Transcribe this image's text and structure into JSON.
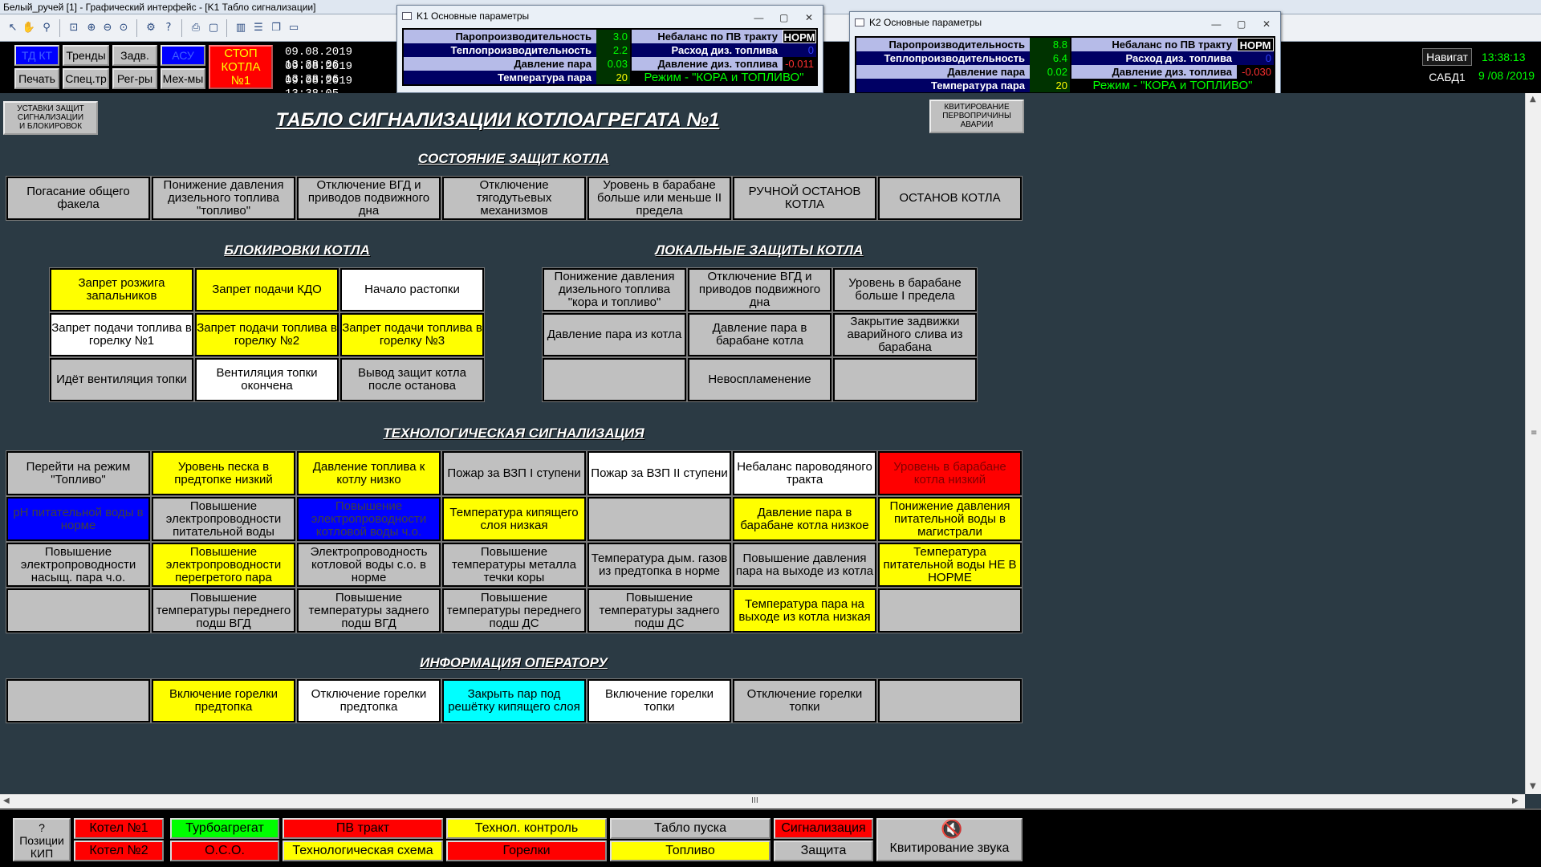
{
  "app": {
    "title": "Белый_ручей [1] - Графический интерфейс - [K1 Табло сигнализации]"
  },
  "toolbar": {
    "icons": [
      "cursor-icon",
      "hand-icon",
      "zoom-icon",
      "fit-icon",
      "zoom-in-icon",
      "zoom-out-icon",
      "zoom-reset-icon",
      "tools-icon",
      "help-icon",
      "print-icon",
      "window-icon",
      "layout-icon",
      "list-icon",
      "windows-icon",
      "screen-icon"
    ]
  },
  "cmd": {
    "row1": [
      "ТД КТ",
      "Тренды",
      "Задв.",
      "АСУ"
    ],
    "row2": [
      "Печать",
      "Спец.тр",
      "Рег-ры",
      "Мех-мы"
    ],
    "stop": [
      "СТОП",
      "КОТЛА",
      "№1"
    ],
    "datetimes": [
      "09.08.2019 13:38:06",
      "09.08.2019 13:38:06",
      "09.08.2019 13:38:05"
    ],
    "nav_label": "Навигат",
    "sabd_label": "САБД1",
    "clock_time": "13:38:13",
    "clock_date": "9 /08 /2019"
  },
  "k1": {
    "title": "K1 Основные параметры",
    "rows": [
      {
        "label": "Паропроизводительность",
        "value": "3.0",
        "value_color": "green"
      },
      {
        "label": "Теплопроизводительность",
        "value": "2.2",
        "value_color": "green"
      },
      {
        "label": "Давление пара",
        "value": "0.03",
        "value_color": "green"
      },
      {
        "label": "Температура пара",
        "value": "20",
        "value_color": "yellow"
      }
    ],
    "right_rows": [
      {
        "label": "Небаланс по ПВ тракту",
        "value": "НОРМ"
      },
      {
        "label": "Расход диз. топлива",
        "value": "0"
      },
      {
        "label": "Давление диз. топлива",
        "value": "-0.011"
      }
    ],
    "mode": "Режим - \"КОРА и ТОПЛИВО\""
  },
  "k2": {
    "title": "K2 Основные параметры",
    "rows": [
      {
        "label": "Паропроизводительность",
        "value": "8.8"
      },
      {
        "label": "Теплопроизводительность",
        "value": "6.4"
      },
      {
        "label": "Давление пара",
        "value": "0.02"
      },
      {
        "label": "Температура пара",
        "value": "20"
      }
    ],
    "right_rows": [
      {
        "label": "Небаланс по ПВ тракту",
        "value": "НОРМ"
      },
      {
        "label": "Расход диз. топлива",
        "value": "0"
      },
      {
        "label": "Давление диз. топлива",
        "value": "-0.030"
      }
    ],
    "mode": "Режим - \"КОРА и ТОПЛИВО\""
  },
  "panel": {
    "left_button": [
      "УСТАВКИ ЗАЩИТ",
      "СИГНАЛИЗАЦИИ",
      "И БЛОКИРОВОК"
    ],
    "right_button": [
      "КВИТИРОВАНИЕ",
      "ПЕРВОПРИЧИНЫ",
      "АВАРИИ"
    ],
    "title": "ТАБЛО СИГНАЛИЗАЦИИ КОТЛОАГРЕГАТА №1",
    "sections": {
      "protection": "СОСТОЯНИЕ ЗАЩИТ КОТЛА",
      "blocking": "БЛОКИРОВКИ КОТЛА",
      "local": "ЛОКАЛЬНЫЕ ЗАЩИТЫ КОТЛА",
      "tech": "ТЕХНОЛОГИЧЕСКАЯ СИГНАЛИЗАЦИЯ",
      "info": "ИНФОРМАЦИЯ ОПЕРАТОРУ"
    },
    "protection_cells": [
      {
        "text": "Погасание общего факела",
        "color": "gray"
      },
      {
        "text": "Понижение давления дизельного топлива \"топливо\"",
        "color": "gray"
      },
      {
        "text": "Отключение ВГД и приводов подвижного дна",
        "color": "gray"
      },
      {
        "text": "Отключение тягодутьевых механизмов",
        "color": "gray"
      },
      {
        "text": "Уровень в барабане больше или меньше II предела",
        "color": "gray"
      },
      {
        "text": "РУЧНОЙ ОСТАНОВ КОТЛА",
        "color": "gray"
      },
      {
        "text": "ОСТАНОВ КОТЛА",
        "color": "gray"
      }
    ],
    "blocking_cells": [
      {
        "text": "Запрет розжига запальников",
        "color": "yellow"
      },
      {
        "text": "Запрет подачи КДО",
        "color": "yellow"
      },
      {
        "text": "Начало растопки",
        "color": "white"
      },
      {
        "text": "Запрет подачи топлива в горелку №1",
        "color": "white"
      },
      {
        "text": "Запрет подачи топлива в горелку №2",
        "color": "yellow"
      },
      {
        "text": "Запрет подачи топлива в горелку №3",
        "color": "yellow"
      },
      {
        "text": "Идёт вентиляция топки",
        "color": "gray"
      },
      {
        "text": "Вентиляция топки окончена",
        "color": "white"
      },
      {
        "text": "Вывод защит котла после останова",
        "color": "gray"
      }
    ],
    "local_cells": [
      {
        "text": "Понижение давления дизельного топлива \"кора и топливо\"",
        "color": "gray"
      },
      {
        "text": "Отключение ВГД и приводов подвижного дна",
        "color": "gray"
      },
      {
        "text": "Уровень в барабане больше I предела",
        "color": "gray"
      },
      {
        "text": "Давление пара из котла",
        "color": "gray"
      },
      {
        "text": "Давление пара в барабане котла",
        "color": "gray"
      },
      {
        "text": "Закрытие задвижки аварийного слива из барабана",
        "color": "gray"
      },
      {
        "text": "",
        "color": "gray"
      },
      {
        "text": "Невоспламенение",
        "color": "gray"
      },
      {
        "text": "",
        "color": "gray"
      }
    ],
    "tech_cells": [
      {
        "text": "Перейти на режим \"Топливо\"",
        "color": "gray"
      },
      {
        "text": "Уровень песка в предтопке низкий",
        "color": "yellow"
      },
      {
        "text": "Давление топлива к котлу низко",
        "color": "yellow"
      },
      {
        "text": "Пожар за ВЗП I ступени",
        "color": "gray"
      },
      {
        "text": "Пожар за ВЗП II ступени",
        "color": "white"
      },
      {
        "text": "Небаланс пароводяного тракта",
        "color": "white"
      },
      {
        "text": "Уровень в барабане котла низкий",
        "color": "red"
      },
      {
        "text": "pH питательной воды в норме",
        "color": "blue"
      },
      {
        "text": "Повышение электропроводности питательной воды",
        "color": "gray"
      },
      {
        "text": "Повышение электропроводности котловой воды ч.о.",
        "color": "blue"
      },
      {
        "text": "Температура кипящего слоя низкая",
        "color": "yellow"
      },
      {
        "text": "",
        "color": "gray"
      },
      {
        "text": "Давление пара в барабане котла низкое",
        "color": "yellow"
      },
      {
        "text": "Понижение давления питательной воды в магистрали",
        "color": "yellow"
      },
      {
        "text": "Повышение электропроводности насыщ. пара ч.о.",
        "color": "gray"
      },
      {
        "text": "Повышение электропроводности перегретого пара",
        "color": "yellow"
      },
      {
        "text": "Электропроводность котловой воды с.о. в норме",
        "color": "gray"
      },
      {
        "text": "Повышение температуры металла течки коры",
        "color": "gray"
      },
      {
        "text": "Температура дым. газов из предтопка в норме",
        "color": "gray"
      },
      {
        "text": "Повышение давления пара на выходе из котла",
        "color": "gray"
      },
      {
        "text": "Температура питательной воды НЕ В НОРМЕ",
        "color": "yellow"
      },
      {
        "text": "",
        "color": "gray"
      },
      {
        "text": "Повышение температуры переднего подш ВГД",
        "color": "gray"
      },
      {
        "text": "Повышение температуры заднего подш ВГД",
        "color": "gray"
      },
      {
        "text": "Повышение температуры переднего подш ДС",
        "color": "gray"
      },
      {
        "text": "Повышение температуры заднего подш ДС",
        "color": "gray"
      },
      {
        "text": "Температура пара на выходе из котла низкая",
        "color": "yellow"
      },
      {
        "text": "",
        "color": "gray"
      }
    ],
    "info_cells": [
      {
        "text": "",
        "color": "gray"
      },
      {
        "text": "Включение горелки предтопка",
        "color": "yellow"
      },
      {
        "text": "Отключение горелки предтопка",
        "color": "white"
      },
      {
        "text": "Закрыть пар под решётку кипящего слоя",
        "color": "cyan"
      },
      {
        "text": "Включение горелки топки",
        "color": "white"
      },
      {
        "text": "Отключение горелки топки",
        "color": "gray"
      },
      {
        "text": "",
        "color": "gray"
      }
    ]
  },
  "scroll": {
    "hmark": "III"
  },
  "bottom": {
    "help": [
      "?",
      "Позиции",
      "КИП"
    ],
    "buttons": [
      {
        "label": "Котел №1",
        "color": "red"
      },
      {
        "label": "Котел №2",
        "color": "red"
      },
      {
        "label": "Турбоагрегат",
        "color": "green"
      },
      {
        "label": "О.С.О.",
        "color": "red"
      },
      {
        "label": "ПВ тракт",
        "color": "red"
      },
      {
        "label": "Технологическая схема",
        "color": "yellow"
      },
      {
        "label": "Технол. контроль",
        "color": "yellow"
      },
      {
        "label": "Горелки",
        "color": "red"
      },
      {
        "label": "Табло пуска",
        "color": "gray"
      },
      {
        "label": "Топливо",
        "color": "yellow"
      },
      {
        "label": "Сигнализация",
        "color": "red"
      },
      {
        "label": "Защита",
        "color": "gray"
      }
    ],
    "sound": "Квитирование звука"
  }
}
